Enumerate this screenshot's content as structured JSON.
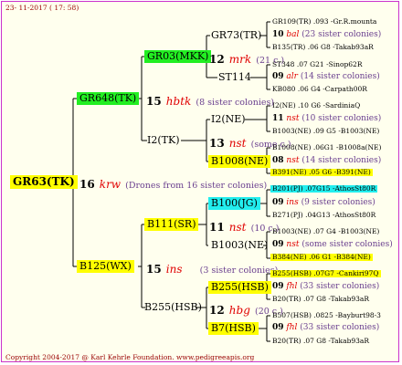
{
  "header": {
    "date": "23- 11-2017 ( 17: 58)"
  },
  "footer": {
    "copyright": "Copyright 2004-2017 @ Karl Kehrle Foundation.",
    "site": "www.pedigreeapis.org"
  },
  "root": {
    "label": "GR63(TK)"
  },
  "gen1": {
    "number": "16",
    "mark": "krw",
    "note": "(Drones from 16 sister colonies)",
    "father": {
      "label": "GR648(TK)",
      "number": "15",
      "mark": "hbtk",
      "note": "(8 sister colonies)"
    },
    "mother": {
      "label": "B125(WX)",
      "number": "15",
      "mark": "ins",
      "note": "(3 sister colonies)"
    }
  },
  "gen2": {
    "gr03": {
      "label": "GR03(MKK)",
      "number": "12",
      "mark": "mrk",
      "note": "(21 c.)"
    },
    "i2tk": {
      "label": "I2(TK)",
      "number": "13",
      "mark": "nst",
      "note": "(some c.)"
    },
    "b111": {
      "label": "B111(SR)",
      "number": "11",
      "mark": "nst",
      "note": "(10 c.)"
    },
    "b255": {
      "label": "B255(HSB)",
      "number": "12",
      "mark": "hbg",
      "note": "(20 c.)"
    }
  },
  "gen3": {
    "gr73": {
      "label": "GR73(TR)"
    },
    "st114": {
      "label": "ST114"
    },
    "i2ne": {
      "label": "I2(NE)"
    },
    "b1008": {
      "label": "B1008(NE)"
    },
    "b100jg": {
      "label": "B100(JG)"
    },
    "b1003": {
      "label": "B1003(NE)"
    },
    "b255hsb": {
      "label": "B255(HSB)"
    },
    "b7": {
      "label": "B7(HSB)"
    }
  },
  "gen4": [
    {
      "top": "GR109(TR) .093 -Gr.R.mounta",
      "num": "10",
      "mark": "bal",
      "count": "(23 sister colonies)",
      "bottom": "B135(TR) .06 G8 -Takab93aR"
    },
    {
      "top": "ST348 .07 G21 -Sinop62R",
      "num": "09",
      "mark": "alr",
      "count": "(14 sister colonies)",
      "bottom": "KB080 .06 G4 -Carpath00R"
    },
    {
      "top": "I2(NE) .10 G6 -SardiniaQ",
      "num": "11",
      "mark": "nst",
      "count": "(10 sister colonies)",
      "bottom": "B1003(NE) .09 G5 -B1003(NE)"
    },
    {
      "top": "B1008(NE) .06G1 -B1008a(NE)",
      "num": "08",
      "mark": "nst",
      "count": "(14 sister colonies)",
      "bottom": "B391(NE) .05 G6 -B391(NE)"
    },
    {
      "top": "B201(PJ) .07G15 -AthosSt80R",
      "num": "09",
      "mark": "ins",
      "count": "(9 sister colonies)",
      "bottom": "B271(PJ) .04G13 -AthosSt80R"
    },
    {
      "top": "B1003(NE) .07 G4 -B1003(NE)",
      "num": "09",
      "mark": "nst",
      "count": "(some sister colonies)",
      "bottom": "B384(NE) .06 G1 -B384(NE)"
    },
    {
      "top": "B255(HSB) .07G7 -Cankiri97Q",
      "num": "09",
      "mark": "fhl",
      "count": "(33 sister colonies)",
      "bottom": "B20(TR) .07 G8 -Takab93aR"
    },
    {
      "top": "B507(HSB) .0825 -Bayburt98-3",
      "num": "09",
      "mark": "fhl",
      "count": "(33 sister colonies)",
      "bottom": "B20(TR) .07 G8 -Takab93aR"
    }
  ]
}
